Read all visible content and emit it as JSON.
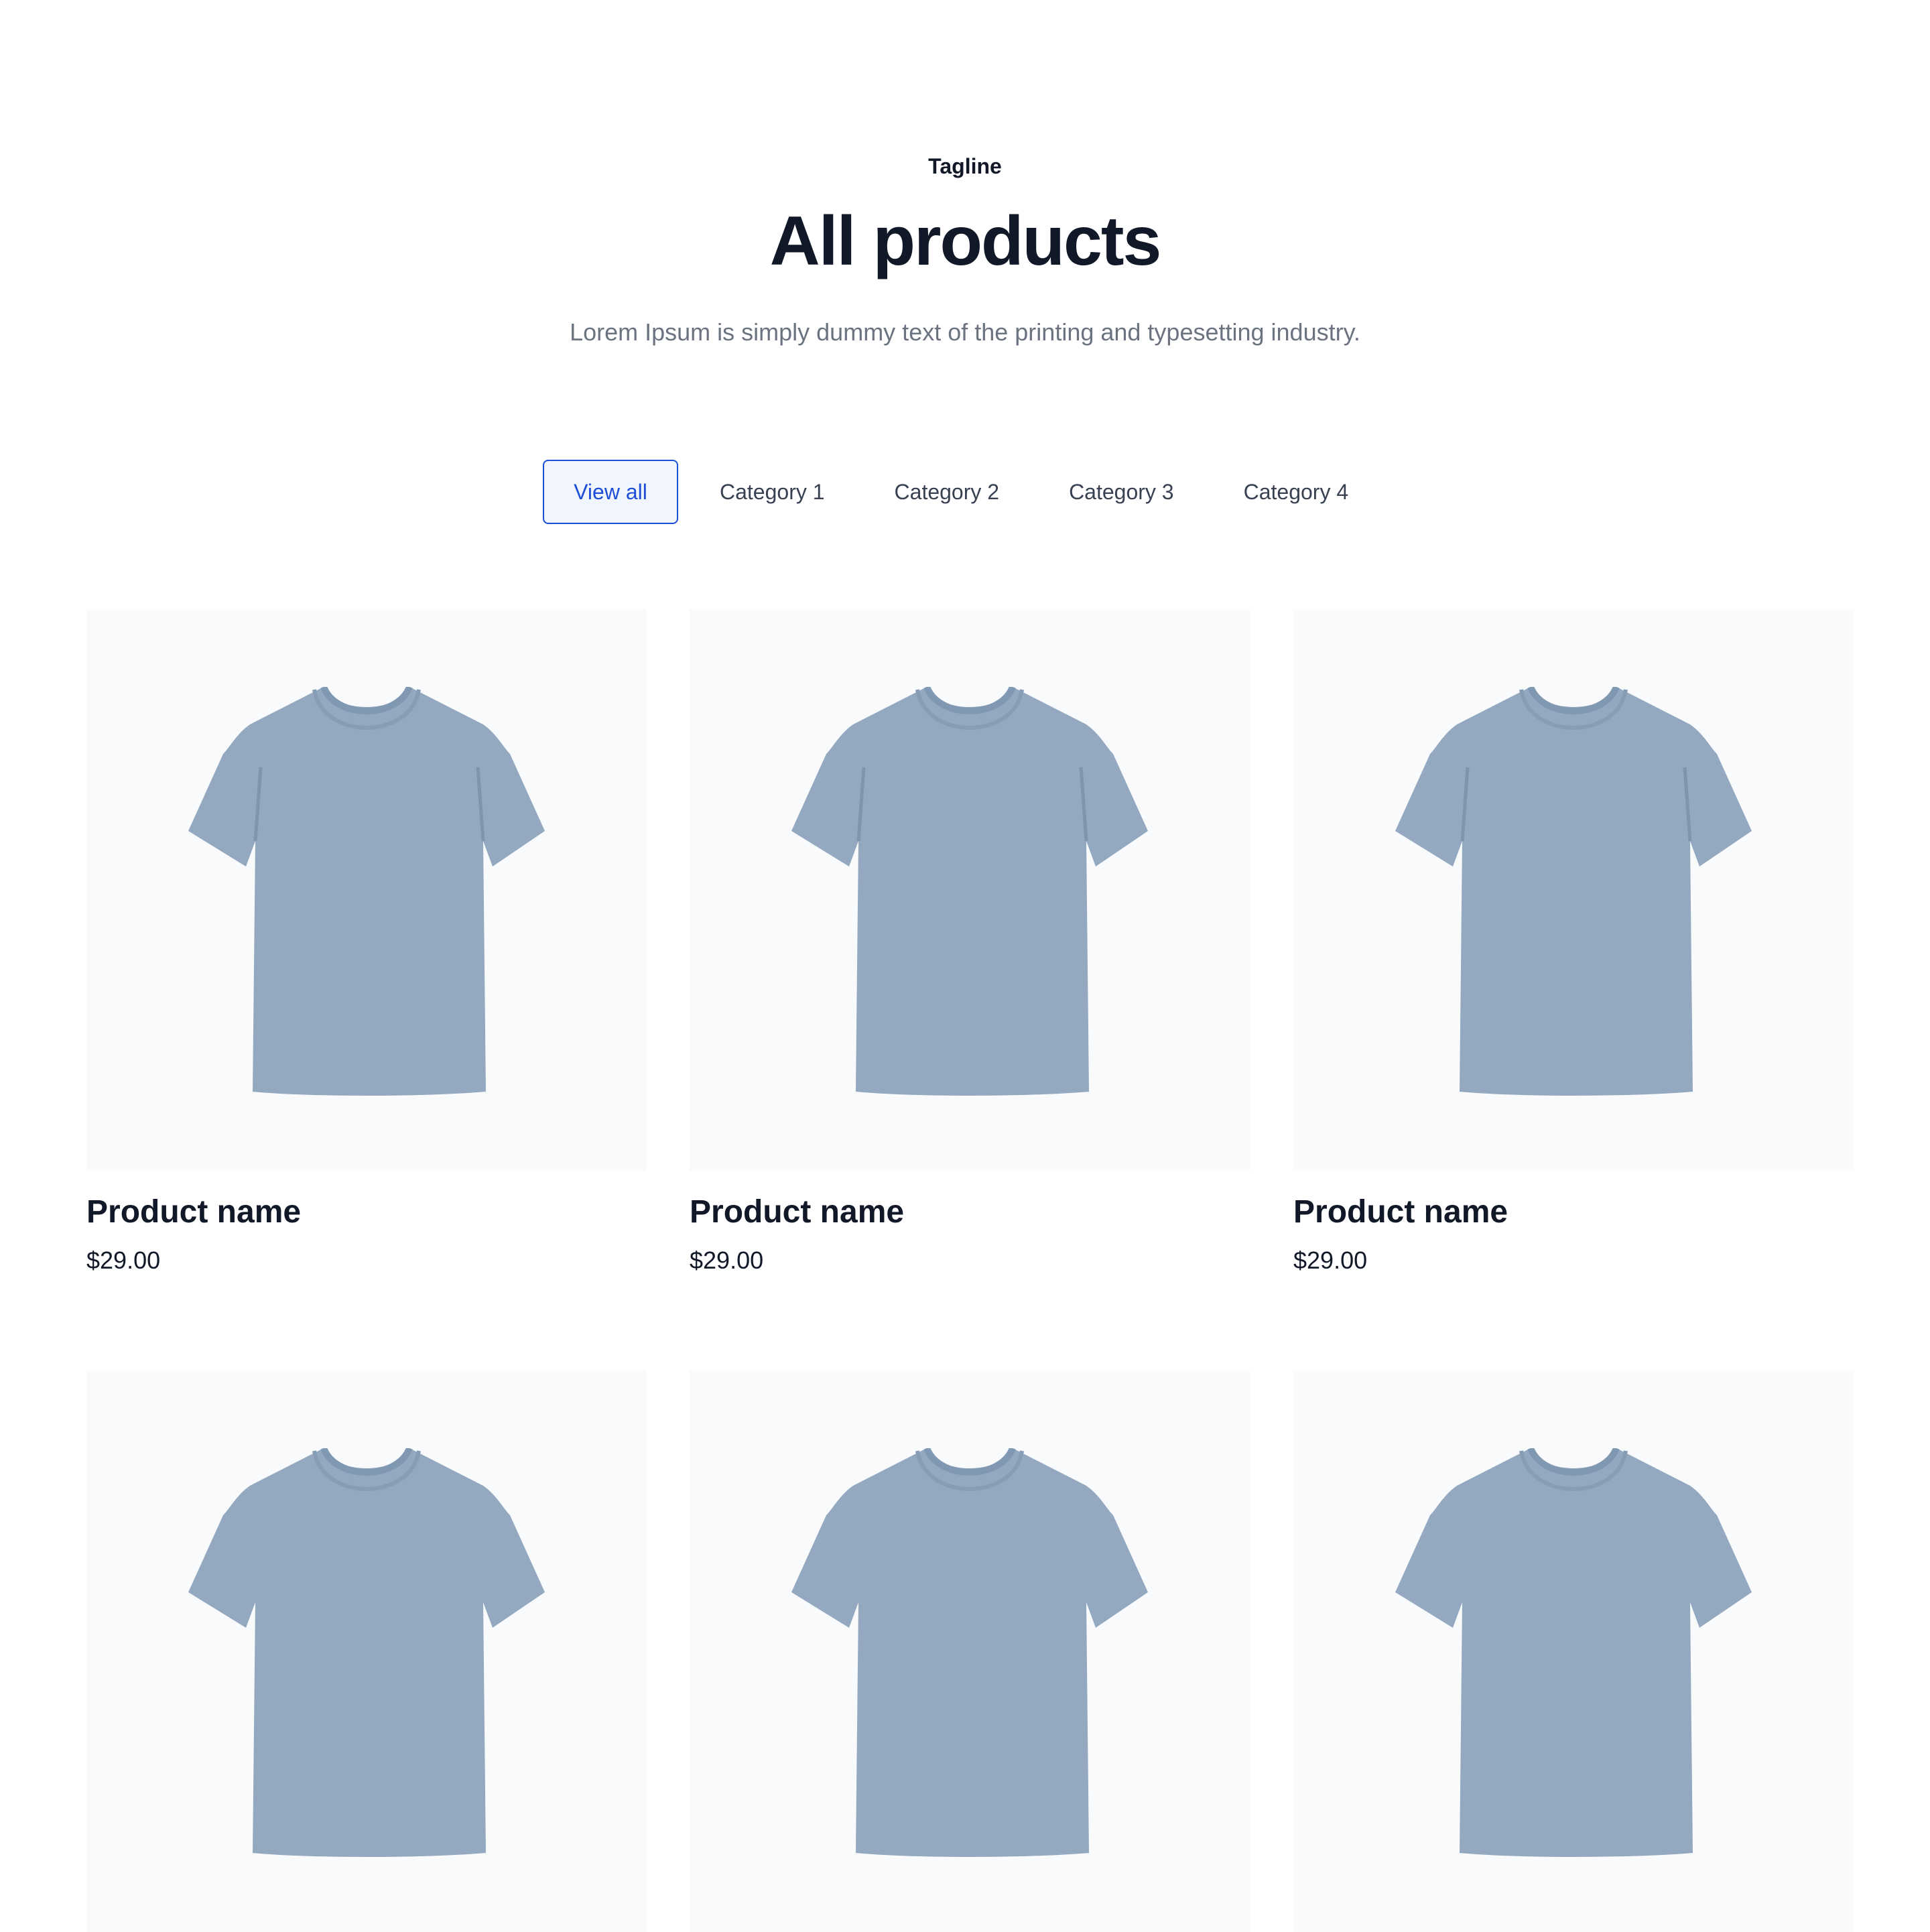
{
  "header": {
    "tagline": "Tagline",
    "title": "All products",
    "subtitle": "Lorem Ipsum is simply dummy text of the printing and typesetting industry."
  },
  "tabs": [
    {
      "label": "View all",
      "active": true
    },
    {
      "label": "Category 1",
      "active": false
    },
    {
      "label": "Category 2",
      "active": false
    },
    {
      "label": "Category 3",
      "active": false
    },
    {
      "label": "Category 4",
      "active": false
    }
  ],
  "products": [
    {
      "name": "Product name",
      "price": "$29.00"
    },
    {
      "name": "Product name",
      "price": "$29.00"
    },
    {
      "name": "Product name",
      "price": "$29.00"
    },
    {
      "name": "",
      "price": ""
    },
    {
      "name": "",
      "price": ""
    },
    {
      "name": "",
      "price": ""
    }
  ],
  "colors": {
    "accent": "#1d4ed8",
    "tab_active_bg": "#f1f5fd",
    "text_dark": "#111827",
    "text_muted": "#6b7280",
    "image_bg": "#f8fafc",
    "shirt": "#94a9c0"
  },
  "icons": {
    "product_image": "tshirt-image"
  }
}
